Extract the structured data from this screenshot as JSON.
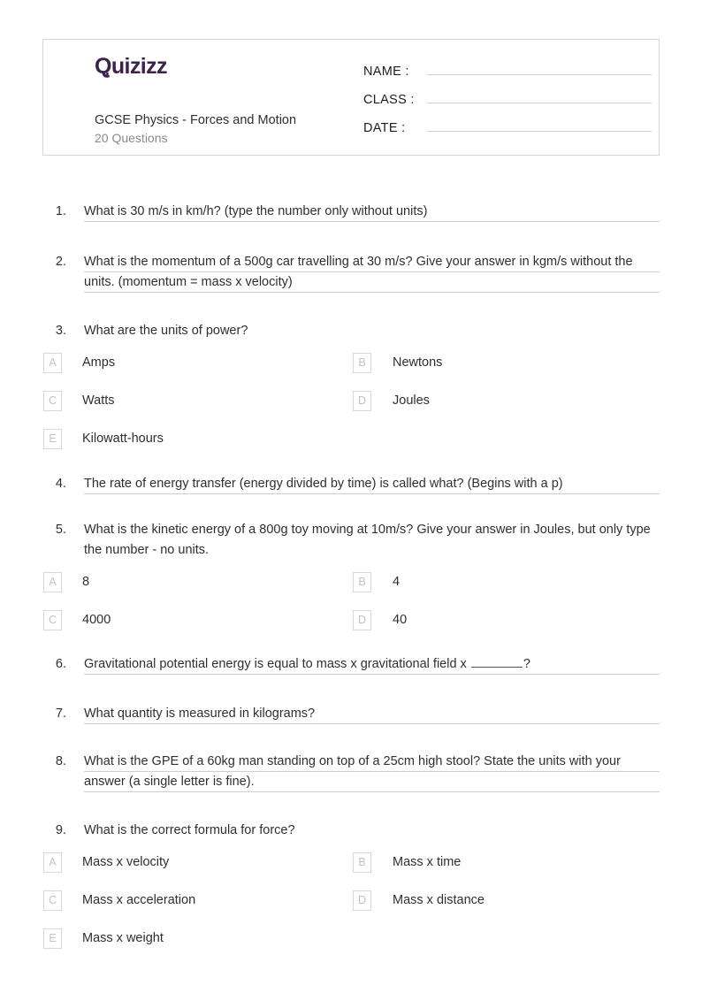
{
  "header": {
    "logo_text": "Quizizz",
    "quiz_title": "GCSE Physics - Forces and Motion",
    "question_count_label": "20 Questions",
    "fields": [
      {
        "label": "NAME :",
        "value": ""
      },
      {
        "label": "CLASS :",
        "value": ""
      },
      {
        "label": "DATE  :",
        "value": ""
      }
    ],
    "brand_color": "#3d2348"
  },
  "questions": [
    {
      "number": "1.",
      "text": "What is 30 m/s in km/h? (type the number only without units)",
      "type": "fill-in",
      "answer_lines": 1,
      "options": []
    },
    {
      "number": "2.",
      "text": "What is the momentum of a 500g car travelling at 30 m/s? Give your answer in kgm/s without the units. (momentum = mass x velocity)",
      "type": "fill-in",
      "answer_lines": 2,
      "options": []
    },
    {
      "number": "3.",
      "text": "What are the units of power?",
      "type": "multiple-choice",
      "answer_lines": 0,
      "options": [
        {
          "letter": "A",
          "label": "Amps"
        },
        {
          "letter": "B",
          "label": "Newtons"
        },
        {
          "letter": "C",
          "label": "Watts"
        },
        {
          "letter": "D",
          "label": "Joules"
        },
        {
          "letter": "E",
          "label": "Kilowatt-hours"
        }
      ]
    },
    {
      "number": "4.",
      "text": "The rate of energy transfer (energy divided by time) is called what? (Begins with a p)",
      "type": "fill-in",
      "answer_lines": 1,
      "options": []
    },
    {
      "number": "5.",
      "text": "What is the kinetic energy of a 800g toy moving at 10m/s? Give your answer in Joules, but only type the number - no units.",
      "type": "multiple-choice",
      "answer_lines": 0,
      "options": [
        {
          "letter": "A",
          "label": "8"
        },
        {
          "letter": "B",
          "label": "4"
        },
        {
          "letter": "C",
          "label": "4000"
        },
        {
          "letter": "D",
          "label": "40"
        }
      ]
    },
    {
      "number": "6.",
      "text_before_blank": "Gravitational potential energy is equal to mass x gravitational field x ",
      "text_after_blank": "?",
      "text": "Gravitational potential energy is equal to mass x gravitational field x ______?",
      "type": "fill-in-blank",
      "answer_lines": 1,
      "options": []
    },
    {
      "number": "7.",
      "text": "What quantity is measured in kilograms?",
      "type": "fill-in",
      "answer_lines": 1,
      "options": []
    },
    {
      "number": "8.",
      "text": "What is the GPE of a 60kg man standing on top of a 25cm high stool? State the units with your answer (a single letter is fine).",
      "type": "fill-in",
      "answer_lines": 2,
      "options": []
    },
    {
      "number": "9.",
      "text": "What is the correct formula for force?",
      "type": "multiple-choice",
      "answer_lines": 0,
      "options": [
        {
          "letter": "A",
          "label": "Mass x velocity"
        },
        {
          "letter": "B",
          "label": "Mass x time"
        },
        {
          "letter": "C",
          "label": "Mass x acceleration"
        },
        {
          "letter": "D",
          "label": "Mass x distance"
        },
        {
          "letter": "E",
          "label": "Mass x weight"
        }
      ]
    }
  ]
}
